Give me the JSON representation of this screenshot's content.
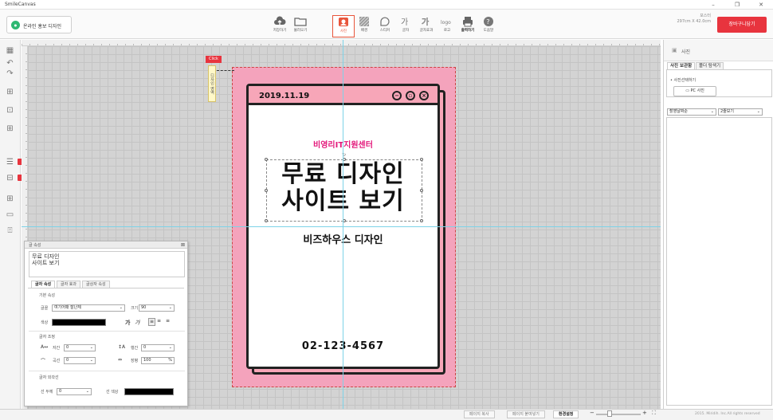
{
  "window": {
    "title": "SmileCanvas"
  },
  "header": {
    "brand_label": "온라인 홍보 디자인",
    "tools": [
      {
        "label": "저장하기",
        "icon": "cloud-upload-icon"
      },
      {
        "label": "불러오기",
        "icon": "folder-icon"
      },
      {
        "label": "사진",
        "icon": "photo-icon"
      },
      {
        "label": "배경",
        "icon": "pattern-icon"
      },
      {
        "label": "스티커",
        "icon": "sticker-icon"
      },
      {
        "label": "글자",
        "icon": "text-icon"
      },
      {
        "label": "글자효과",
        "icon": "text-effect-icon"
      },
      {
        "label": "로고",
        "icon": "logo-icon"
      },
      {
        "label": "출력하기",
        "icon": "printer-icon"
      },
      {
        "label": "도움말",
        "icon": "help-icon"
      }
    ],
    "product_type": "포스터",
    "product_size": "297cm X 42.0cm",
    "cart_button": "장바구니담기"
  },
  "left_toolbar": {
    "new_badge_1": "NEW",
    "new_badge_2": "NEW"
  },
  "canvas": {
    "click_tag": "Click",
    "vertical_label": "디자인 영역",
    "date": "2019.11.19",
    "organization": "비영리IT지원센터",
    "headline_line1": "무료 디자인",
    "headline_line2": "사이트 보기",
    "brand_line": "비즈하우스 디자인",
    "phone": "02-123-4567"
  },
  "text_panel": {
    "title": "글 속성",
    "text_value_line1": "무료 디자인",
    "text_value_line2": "사이트 보기",
    "tabs": [
      "글자 속성",
      "글자 효과",
      "글상자 속성"
    ],
    "section_basic": "기본 속성",
    "font_label": "글꼴",
    "font_value": "여기어때 잘난체",
    "size_label": "크기",
    "size_value": "90",
    "color_label": "색상",
    "style_bold": "가",
    "style_italic": "가",
    "section_adjust": "글자 조정",
    "spacing_label": "자간",
    "spacing_value": "0",
    "line_label": "행간",
    "line_value": "0",
    "curve_label": "곡선",
    "curve_value": "0",
    "ratio_label": "장평",
    "ratio_value": "100",
    "ratio_unit": "%",
    "section_outline": "글자 외곽선",
    "outline_width_label": "선 두께",
    "outline_width_value": "0",
    "outline_color_label": "선 색상",
    "text_color": "#000000",
    "outline_color": "#000000"
  },
  "right_panel": {
    "title": "사진",
    "tabs": [
      "사진 보관함",
      "폴더 탐색기"
    ],
    "choose_label": "• 사진선택하기",
    "pc_button": "PC 사진",
    "sort_value": "촬영날짜순",
    "view_value": "2줄보기"
  },
  "status_bar": {
    "copy_page": "페이지 복사",
    "page_order": "페이지 붙여넣기",
    "env_settings": "환경설정",
    "minus": "−",
    "plus": "+",
    "copyright": "2015. Miridih. Inc.All rights reserved"
  },
  "colors": {
    "accent": "#e8343e",
    "poster_pink": "#f7a6b8",
    "headline_magenta": "#e3197b",
    "guide": "#7dd3e8"
  }
}
